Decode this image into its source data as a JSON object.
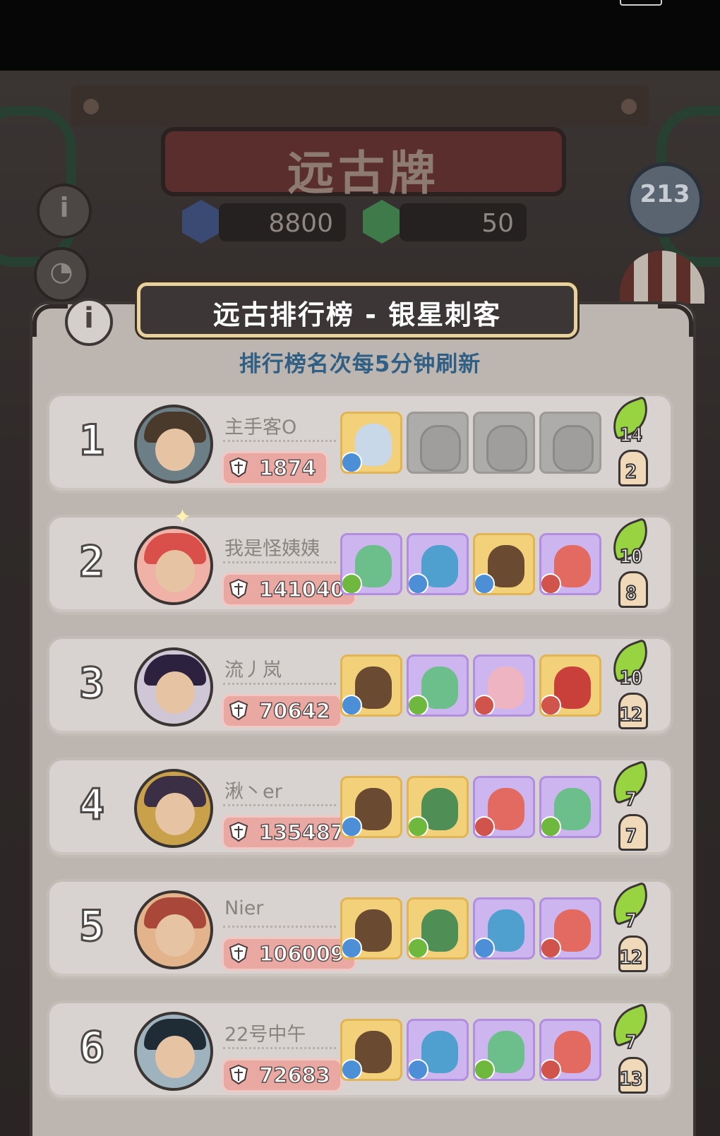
{
  "header": {
    "title": "远古牌",
    "resources": [
      {
        "icon": "blue-crystal-icon",
        "value": "8800",
        "color": "#3b4a73"
      },
      {
        "icon": "green-crystal-icon",
        "value": "50",
        "color": "#3f7a4a"
      }
    ]
  },
  "panel": {
    "title": "远古排行榜 - 银星刺客",
    "subtitle": "排行榜名次每5分钟刷新"
  },
  "players": [
    {
      "rank": "1",
      "name": "主手客O",
      "score": "1874",
      "leaf": "14",
      "knight": "2",
      "avatar_hair": "#4a3a2c",
      "avatar_bg": "#6c7f86",
      "heroes": [
        {
          "frame": "gold",
          "portrait": "#c9d8e8",
          "element": "#4d8fd6"
        },
        {
          "frame": "empty"
        },
        {
          "frame": "empty"
        },
        {
          "frame": "empty"
        }
      ]
    },
    {
      "rank": "2",
      "name": "我是怪姨姨",
      "score": "141040",
      "leaf": "10",
      "knight": "8",
      "avatar_hair": "#d9504b",
      "avatar_bg": "#f0b2a7",
      "heroes": [
        {
          "frame": "purple",
          "portrait": "#6cbf8a",
          "element": "#6fb83e"
        },
        {
          "frame": "purple",
          "portrait": "#4f9fcf",
          "element": "#4d8fd6"
        },
        {
          "frame": "gold",
          "portrait": "#6b4a32",
          "element": "#4d8fd6"
        },
        {
          "frame": "purple",
          "portrait": "#e26a61",
          "element": "#d0544c"
        }
      ]
    },
    {
      "rank": "3",
      "name": "流丿岚",
      "score": "70642",
      "leaf": "10",
      "knight": "12",
      "avatar_hair": "#2c2240",
      "avatar_bg": "#cfc6d6",
      "heroes": [
        {
          "frame": "gold",
          "portrait": "#6b4a32",
          "element": "#4d8fd6"
        },
        {
          "frame": "purple",
          "portrait": "#6cbf8a",
          "element": "#6fb83e"
        },
        {
          "frame": "purple",
          "portrait": "#eeb4c2",
          "element": "#d0544c"
        },
        {
          "frame": "gold",
          "portrait": "#c9403a",
          "element": "#d0544c"
        }
      ]
    },
    {
      "rank": "4",
      "name": "湫丶er",
      "score": "135487",
      "leaf": "7",
      "knight": "7",
      "avatar_hair": "#3b2f46",
      "avatar_bg": "#c9a14a",
      "heroes": [
        {
          "frame": "gold",
          "portrait": "#6b4a32",
          "element": "#4d8fd6"
        },
        {
          "frame": "gold",
          "portrait": "#4f8f56",
          "element": "#6fb83e"
        },
        {
          "frame": "purple",
          "portrait": "#e26a61",
          "element": "#d0544c"
        },
        {
          "frame": "purple",
          "portrait": "#6cbf8a",
          "element": "#6fb83e"
        }
      ]
    },
    {
      "rank": "5",
      "name": "Nier",
      "score": "106009",
      "leaf": "7",
      "knight": "12",
      "avatar_hair": "#a9473a",
      "avatar_bg": "#e3b38c",
      "heroes": [
        {
          "frame": "gold",
          "portrait": "#6b4a32",
          "element": "#4d8fd6"
        },
        {
          "frame": "gold",
          "portrait": "#4f8f56",
          "element": "#6fb83e"
        },
        {
          "frame": "purple",
          "portrait": "#4f9fcf",
          "element": "#4d8fd6"
        },
        {
          "frame": "purple",
          "portrait": "#e26a61",
          "element": "#d0544c"
        }
      ]
    },
    {
      "rank": "6",
      "name": "22号中午",
      "score": "72683",
      "leaf": "7",
      "knight": "13",
      "avatar_hair": "#1f2c36",
      "avatar_bg": "#9fb3bf",
      "heroes": [
        {
          "frame": "gold",
          "portrait": "#6b4a32",
          "element": "#4d8fd6"
        },
        {
          "frame": "purple",
          "portrait": "#4f9fcf",
          "element": "#4d8fd6"
        },
        {
          "frame": "purple",
          "portrait": "#6cbf8a",
          "element": "#6fb83e"
        },
        {
          "frame": "purple",
          "portrait": "#e26a61",
          "element": "#d0544c"
        }
      ]
    }
  ]
}
